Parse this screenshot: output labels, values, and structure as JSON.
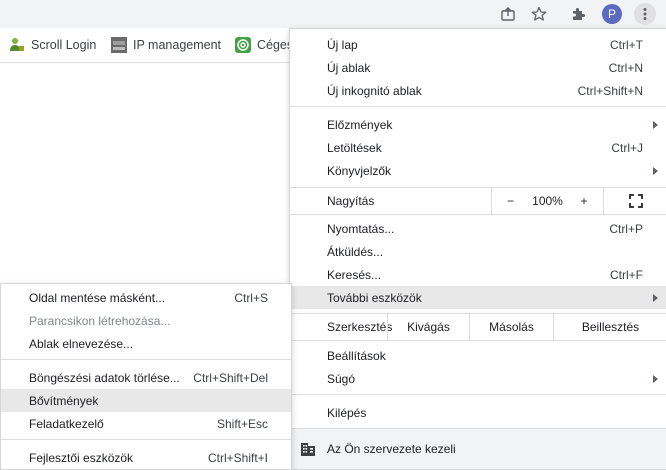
{
  "bookmarks": [
    {
      "label": "Scroll Login",
      "icon": "person-icon"
    },
    {
      "label": "IP management",
      "icon": "php-icon"
    },
    {
      "label": "Céges",
      "icon": "spiral-icon"
    }
  ],
  "toolbar": {
    "profile_initial": "P"
  },
  "menu": {
    "new_tab": {
      "label": "Új lap",
      "shortcut": "Ctrl+T"
    },
    "new_window": {
      "label": "Új ablak",
      "shortcut": "Ctrl+N"
    },
    "incognito": {
      "label": "Új inkognitó ablak",
      "shortcut": "Ctrl+Shift+N"
    },
    "history": {
      "label": "Előzmények"
    },
    "downloads": {
      "label": "Letöltések",
      "shortcut": "Ctrl+J"
    },
    "bookmarks": {
      "label": "Könyvjelzők"
    },
    "zoom": {
      "label": "Nagyítás",
      "minus": "−",
      "value": "100%",
      "plus": "+"
    },
    "print": {
      "label": "Nyomtatás...",
      "shortcut": "Ctrl+P"
    },
    "cast": {
      "label": "Átküldés..."
    },
    "find": {
      "label": "Keresés...",
      "shortcut": "Ctrl+F"
    },
    "more_tools": {
      "label": "További eszközök"
    },
    "edit": {
      "label": "Szerkesztés",
      "cut": "Kivágás",
      "copy": "Másolás",
      "paste": "Beillesztés"
    },
    "settings": {
      "label": "Beállítások"
    },
    "help": {
      "label": "Súgó"
    },
    "exit": {
      "label": "Kilépés"
    },
    "managed": {
      "label": "Az Ön szervezete kezeli"
    }
  },
  "submenu": {
    "save_page": {
      "label": "Oldal mentése másként...",
      "shortcut": "Ctrl+S"
    },
    "create_shortcut": {
      "label": "Parancsikon létrehozása..."
    },
    "name_window": {
      "label": "Ablak elnevezése..."
    },
    "clear_data": {
      "label": "Böngészési adatok törlése...",
      "shortcut": "Ctrl+Shift+Del"
    },
    "extensions": {
      "label": "Bővítmények"
    },
    "task_manager": {
      "label": "Feladatkezelő",
      "shortcut": "Shift+Esc"
    },
    "dev_tools": {
      "label": "Fejlesztői eszközök",
      "shortcut": "Ctrl+Shift+I"
    }
  }
}
